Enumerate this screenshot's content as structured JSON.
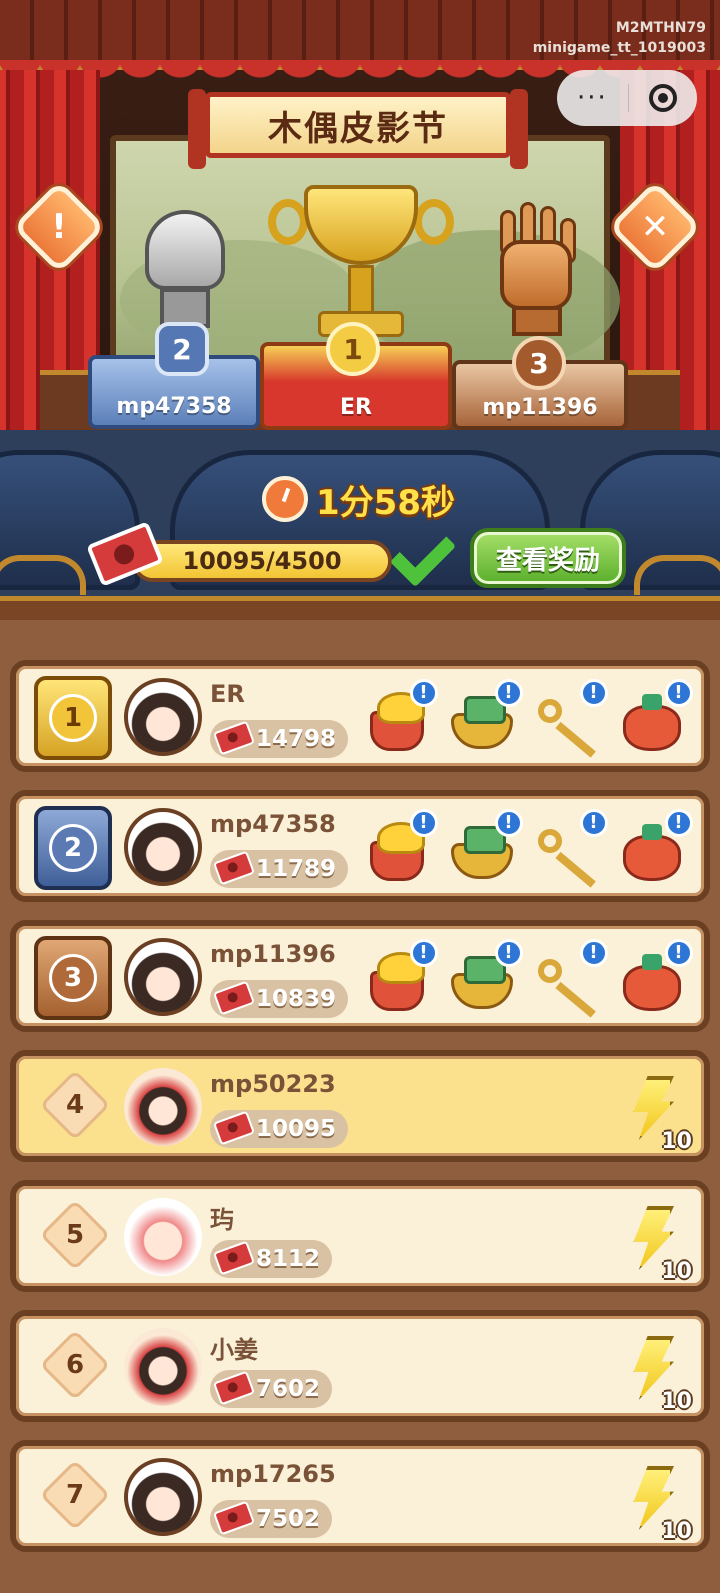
{
  "device": {
    "line1": "M2MTHN79",
    "line2": "minigame_tt_1019003"
  },
  "menu": {
    "dots": "···"
  },
  "banner": {
    "title": "木偶皮影节"
  },
  "buttons": {
    "info": "!",
    "close": "✕",
    "view_rewards": "查看奖励"
  },
  "podium": {
    "first": {
      "rank": "1",
      "name": "ER"
    },
    "second": {
      "rank": "2",
      "name": "mp47358"
    },
    "third": {
      "rank": "3",
      "name": "mp11396"
    }
  },
  "timer": {
    "label": "1分58秒"
  },
  "progress": {
    "text": "10095/4500",
    "fraction": 1.0
  },
  "rows": [
    {
      "rank": "1",
      "name": "ER",
      "score": "14798",
      "reward_icons": [
        "gold-ingot-icon",
        "treasure-chest-icon",
        "key-icon",
        "lucky-bag-icon"
      ]
    },
    {
      "rank": "2",
      "name": "mp47358",
      "score": "11789",
      "reward_icons": [
        "gold-ingot-icon",
        "treasure-chest-icon",
        "key-icon",
        "lucky-bag-icon"
      ]
    },
    {
      "rank": "3",
      "name": "mp11396",
      "score": "10839",
      "reward_icons": [
        "gold-ingot-icon",
        "treasure-chest-icon",
        "key-icon",
        "lucky-bag-icon"
      ]
    },
    {
      "rank": "4",
      "name": "mp50223",
      "score": "10095",
      "reward": "10"
    },
    {
      "rank": "5",
      "name": "玙",
      "score": "8112",
      "reward": "10"
    },
    {
      "rank": "6",
      "name": "小姜",
      "score": "7602",
      "reward": "10"
    },
    {
      "rank": "7",
      "name": "mp17265",
      "score": "7502",
      "reward": "10"
    }
  ],
  "colors": {
    "accent_gold": "#f2c43a",
    "current_user_row": "#fbe08e",
    "reward_button": "#5aae2c"
  }
}
